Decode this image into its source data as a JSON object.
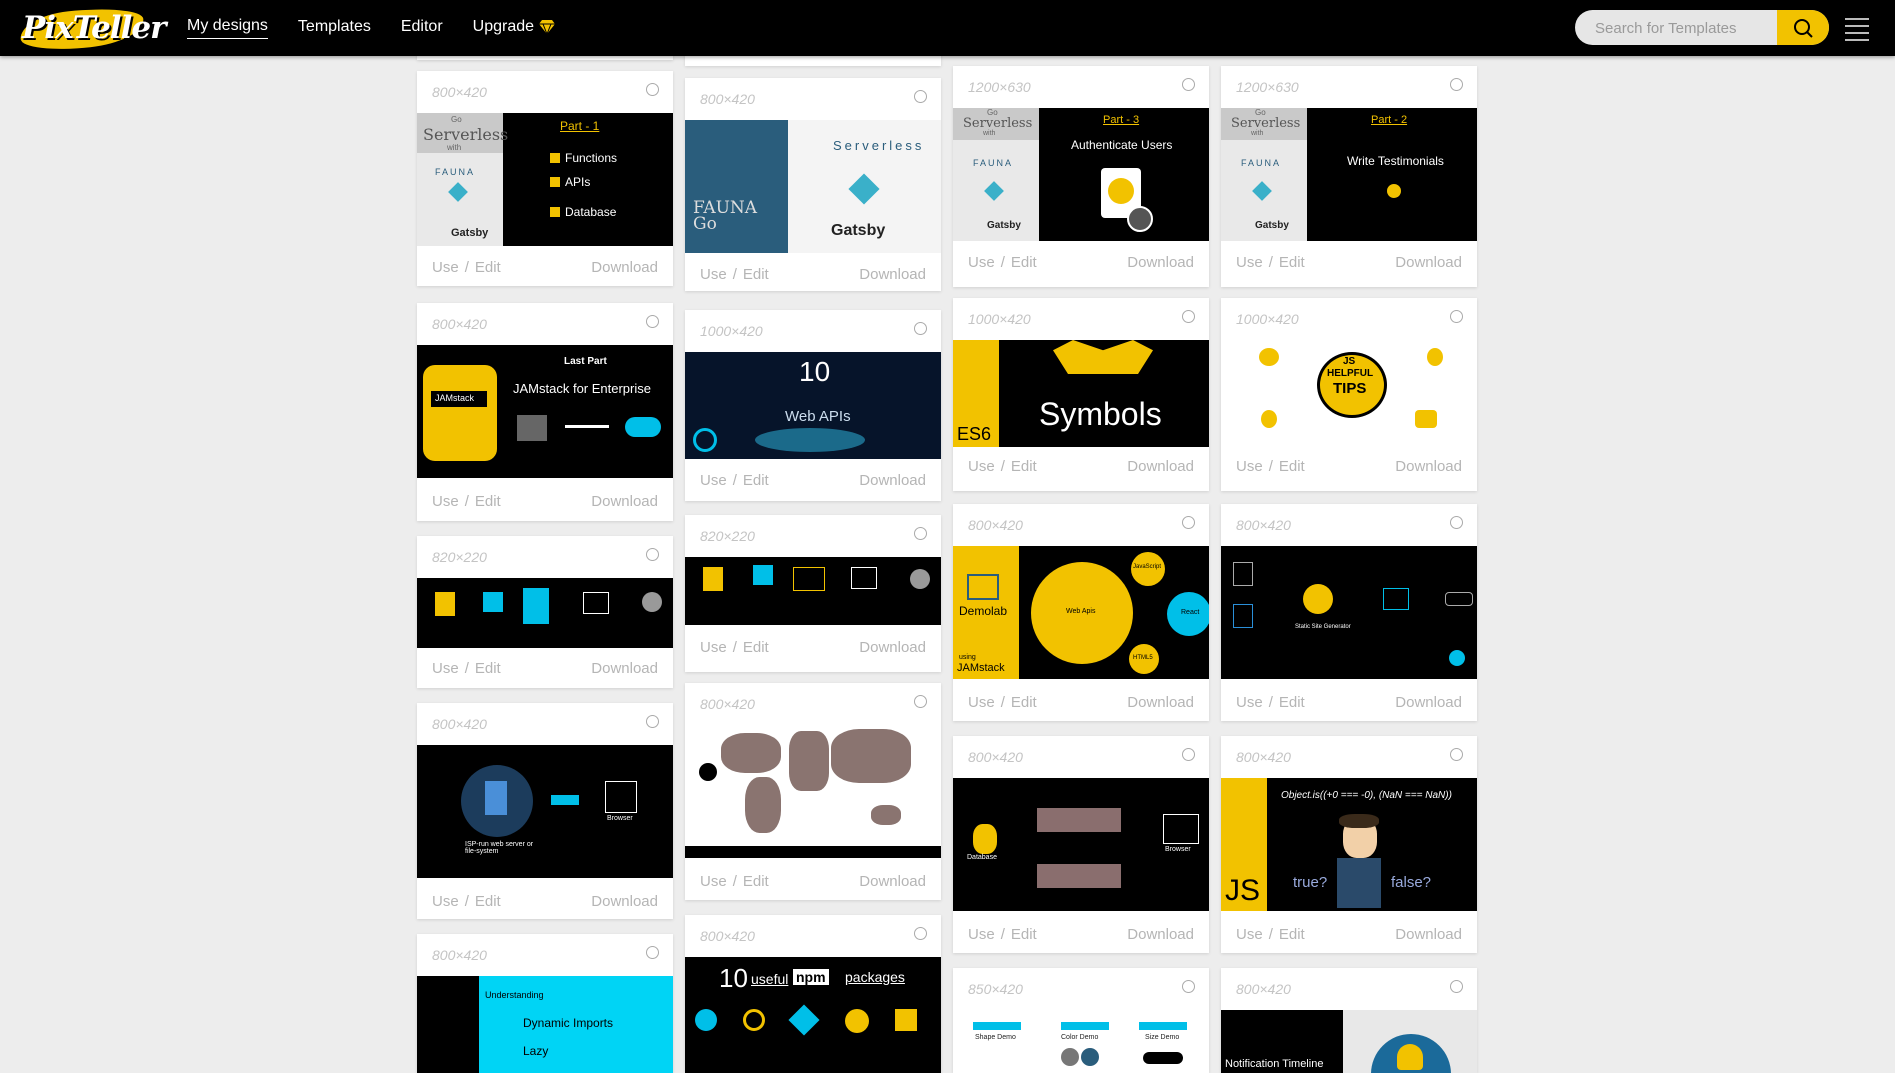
{
  "brand": {
    "logo_text": "PixTeller"
  },
  "nav": [
    {
      "label": "My designs"
    },
    {
      "label": "Templates"
    },
    {
      "label": "Editor"
    },
    {
      "label": "Upgrade"
    }
  ],
  "search": {
    "placeholder": "Search for Templates"
  },
  "actions": {
    "use": "Use",
    "sep": "/",
    "edit": "Edit",
    "download": "Download"
  },
  "cards": [
    {
      "size": "800×420",
      "texts": [
        "Go",
        "Serverless",
        "with",
        "FAUNA",
        "Gatsby",
        "Part - 1",
        "Functions",
        "APIs",
        "Database"
      ]
    },
    {
      "size": "800×420",
      "texts": [
        "Last Part",
        "JAMstack for Enterprise",
        "JAMstack"
      ]
    },
    {
      "size": "820×220",
      "texts": []
    },
    {
      "size": "800×420",
      "texts": [
        "ISP-run web server or file-system",
        "Browser"
      ]
    },
    {
      "size": "800×420",
      "texts": [
        "Understanding",
        "Dynamic Imports",
        "Lazy"
      ]
    },
    {
      "size": "800×420",
      "texts": [
        "FAUNA",
        "Go",
        "Serverless",
        "Gatsby"
      ]
    },
    {
      "size": "1000×420",
      "texts": [
        "10",
        "Web APIs"
      ]
    },
    {
      "size": "820×220",
      "texts": []
    },
    {
      "size": "800×420",
      "texts": []
    },
    {
      "size": "800×420",
      "texts": [
        "10",
        "useful",
        "npm",
        "packages"
      ]
    },
    {
      "size": "1200×630",
      "texts": [
        "Go",
        "Serverless",
        "with",
        "FAUNA",
        "Gatsby",
        "Part - 3",
        "Authenticate Users"
      ]
    },
    {
      "size": "1000×420",
      "texts": [
        "Symbols",
        "ES6"
      ]
    },
    {
      "size": "800×420",
      "texts": [
        "Demolab",
        "using",
        "JAMstack",
        "Web Apis",
        "JavaScript",
        "React",
        "HTML5"
      ]
    },
    {
      "size": "800×420",
      "texts": [
        "Database",
        "Browser"
      ]
    },
    {
      "size": "850×420",
      "texts": [
        "Shape Demo",
        "Color Demo",
        "Size Demo"
      ]
    },
    {
      "size": "1200×630",
      "texts": [
        "Go",
        "Serverless",
        "with",
        "FAUNA",
        "Gatsby",
        "Part - 2",
        "Write Testimonials"
      ]
    },
    {
      "size": "1000×420",
      "texts": [
        "JS",
        "HELPFUL",
        "TIPS"
      ]
    },
    {
      "size": "800×420",
      "texts": [
        "Static Site Generator"
      ]
    },
    {
      "size": "800×420",
      "texts": [
        "Object.is((+0 === -0), (NaN === NaN))",
        "JS",
        "true?",
        "false?"
      ]
    },
    {
      "size": "800×420",
      "texts": [
        "Notification Timeline"
      ]
    }
  ],
  "colors": {
    "accent": "#f2c200",
    "topbar": "#000000",
    "cyan": "#00d4f5",
    "blue_fauna": "#2a5d7c"
  }
}
